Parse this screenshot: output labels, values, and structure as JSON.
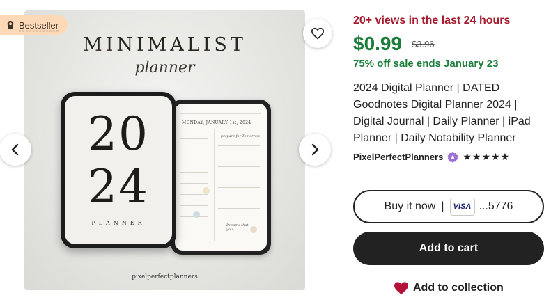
{
  "gallery": {
    "badge_label": "Bestseller",
    "badge_icon": "award-icon",
    "favorite_icon": "heart-outline-icon",
    "prev_icon": "chevron-left-icon",
    "next_icon": "chevron-right-icon",
    "image": {
      "title": "MINIMALIST",
      "subtitle": "planner",
      "year_top": "20",
      "year_bottom": "24",
      "planner_word": "PLANNER",
      "page_header": "MONDAY, JANUARY 1st, 2024",
      "note_1": "prepare for Tomorrow",
      "note_2": "Dreams that you",
      "brand": "pixelperfectplanners"
    }
  },
  "listing": {
    "views": "20+ views in the last 24 hours",
    "price": "$0.99",
    "original_price": "$3.96",
    "sale": "75% off sale ends January 23",
    "title": "2024 Digital Planner | DATED Goodnotes Digital Planner 2024 | Digital Journal | Daily Planner | iPad Planner | Daily Notability Planner",
    "shop_name": "PixelPerfectPlanners",
    "star_seller_icon": "star-seller-badge-icon",
    "rating_stars": "★★★★★",
    "rating_value": 5
  },
  "actions": {
    "buy_label": "Buy it now",
    "separator": "|",
    "card_brand": "VISA",
    "card_last4": "...5776",
    "add_to_cart": "Add to cart",
    "add_to_collection": "Add to collection",
    "collection_icon": "heart-filled-icon"
  },
  "colors": {
    "views": "#a61a2e",
    "price": "#1b7d3a",
    "badge_bg": "#fdd9b8",
    "cart_bg": "#222222",
    "collection_heart": "#b3123a"
  }
}
